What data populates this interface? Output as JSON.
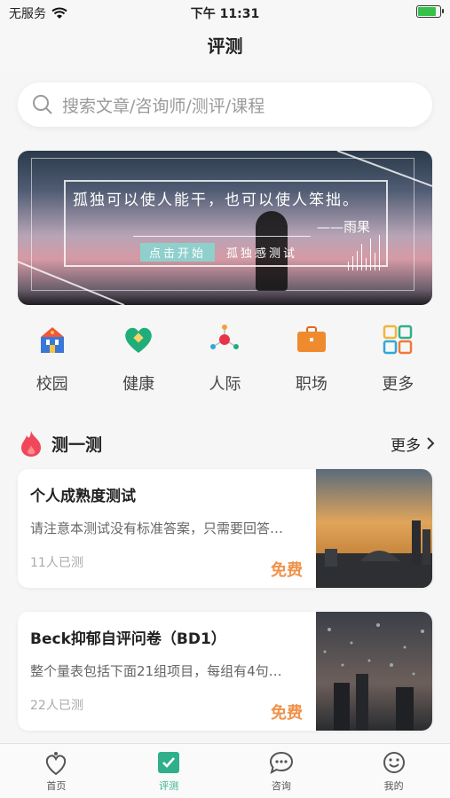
{
  "status": {
    "carrier": "无服务",
    "time": "下午 11:31"
  },
  "nav": {
    "title": "评测"
  },
  "search": {
    "placeholder": "搜索文章/咨询师/测评/课程"
  },
  "banner": {
    "quote": "孤独可以使人能干，也可以使人笨拙。",
    "author": "——雨果",
    "button": "点击开始",
    "test_name": "孤独感测试"
  },
  "categories": [
    {
      "label": "校园",
      "icon": "school-icon"
    },
    {
      "label": "健康",
      "icon": "health-heart-icon"
    },
    {
      "label": "人际",
      "icon": "network-icon"
    },
    {
      "label": "职场",
      "icon": "briefcase-icon"
    },
    {
      "label": "更多",
      "icon": "grid-icon"
    }
  ],
  "section": {
    "title": "测一测",
    "more": "更多"
  },
  "cards": [
    {
      "title": "个人成熟度测试",
      "desc": "请注意本测试没有标准答案，只需要回答…",
      "count": "11人已测",
      "price": "免费"
    },
    {
      "title": "Beck抑郁自评问卷（BD1）",
      "desc": "整个量表包括下面21组项目，每组有4句…",
      "count": "22人已测",
      "price": "免费"
    }
  ],
  "tabs": [
    {
      "label": "首页",
      "icon": "home-heart-icon"
    },
    {
      "label": "评测",
      "icon": "check-box-icon"
    },
    {
      "label": "咨询",
      "icon": "chat-icon"
    },
    {
      "label": "我的",
      "icon": "smile-icon"
    }
  ],
  "colors": {
    "accent": "#2fb08a",
    "price": "#f0924a",
    "fire": "#f0475a"
  }
}
